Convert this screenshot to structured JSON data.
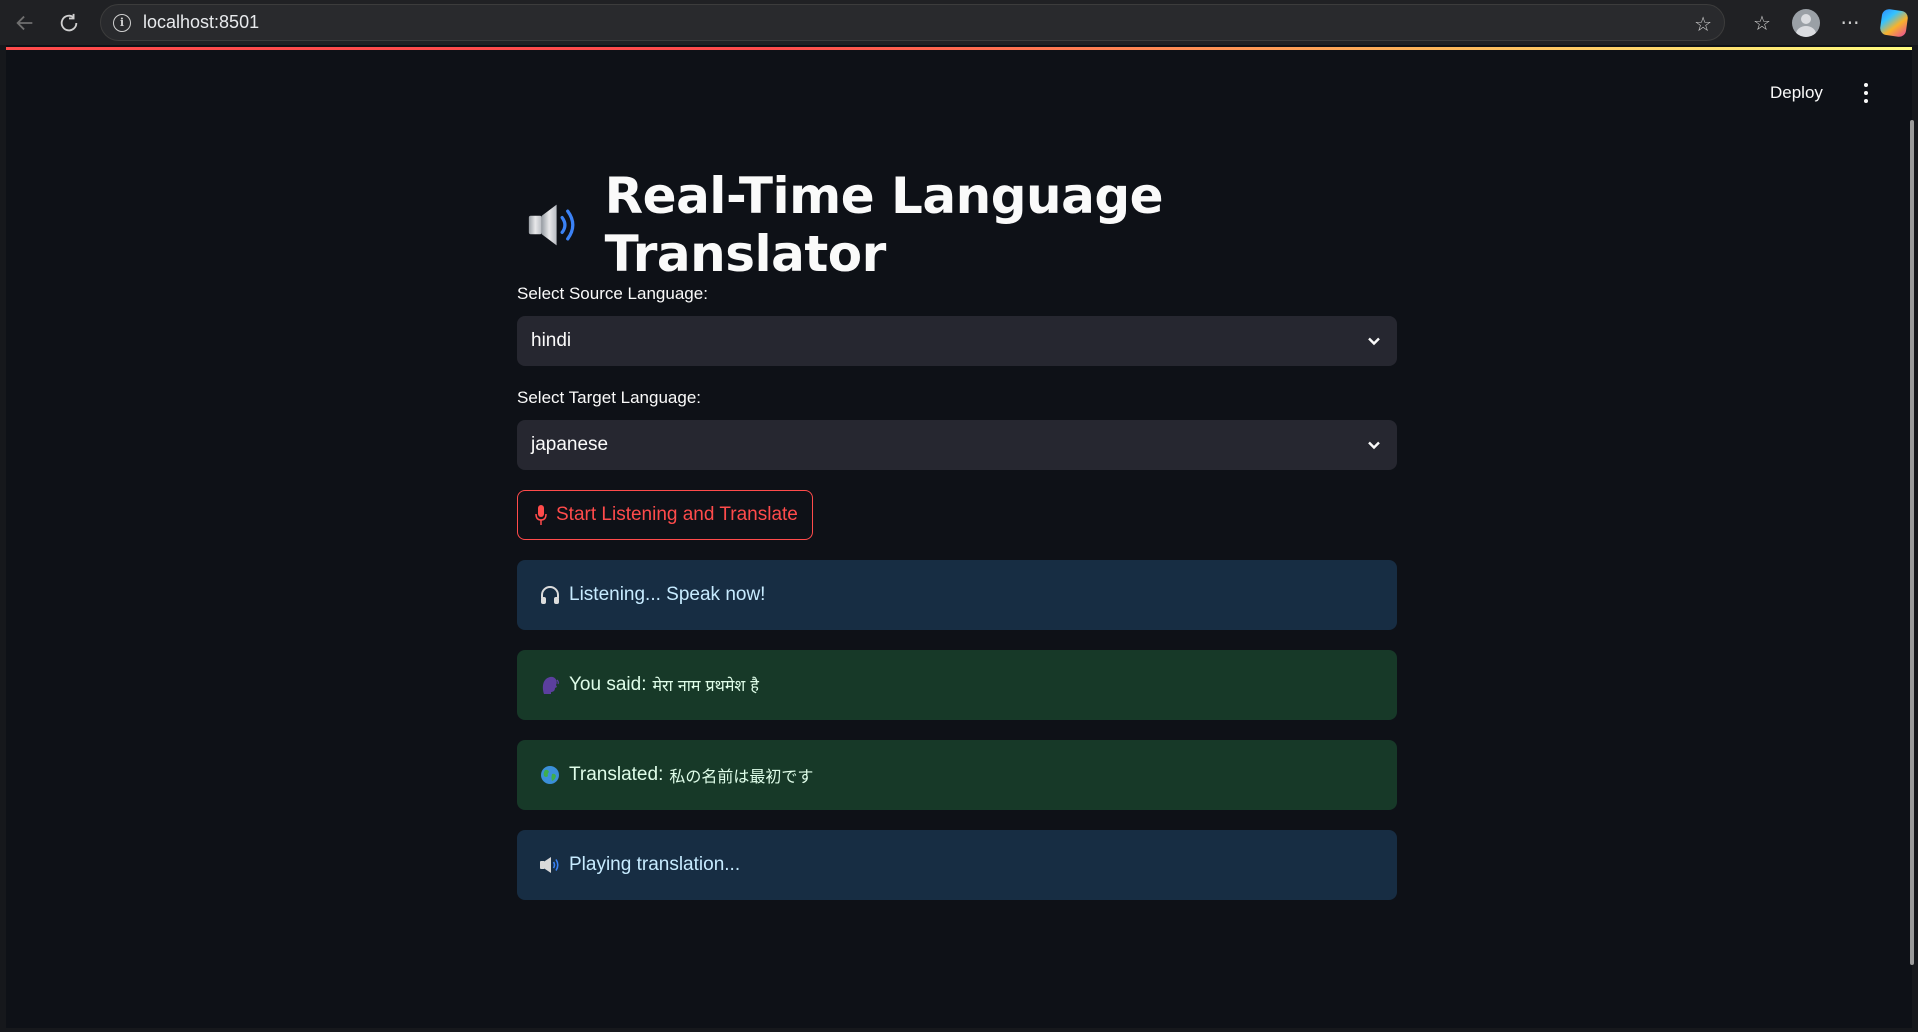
{
  "browser": {
    "url": "localhost:8501",
    "icons": [
      "back-icon",
      "refresh-icon",
      "site-info-icon",
      "favorite-star-icon",
      "favorites-icon",
      "profile-icon",
      "more-icon",
      "copilot-icon"
    ]
  },
  "header": {
    "deploy_label": "Deploy",
    "menu_icon": "vertical-dots-icon"
  },
  "main": {
    "title": "Real-Time Language Translator",
    "title_icon": "speaker-icon",
    "source": {
      "label": "Select Source Language:",
      "value": "hindi"
    },
    "target": {
      "label": "Select Target Language:",
      "value": "japanese"
    },
    "start_button": {
      "icon": "microphone-icon",
      "label": "Start Listening and Translate"
    },
    "alerts": {
      "listening": {
        "icon": "headphones-icon",
        "text": "Listening... Speak now!"
      },
      "you_said": {
        "icon": "speaking-head-icon",
        "label": "You said:",
        "value": "मेरा नाम प्रथमेश है"
      },
      "translated": {
        "icon": "globe-icon",
        "label": "Translated:",
        "value": "私の名前は最初です"
      },
      "playing": {
        "icon": "speaker-icon",
        "text": "Playing translation..."
      }
    }
  },
  "colors": {
    "accent": "#ff4b4b",
    "background": "#0e1117",
    "select_bg": "#262730",
    "info_bg": "#172d43",
    "success_bg": "#173928"
  }
}
